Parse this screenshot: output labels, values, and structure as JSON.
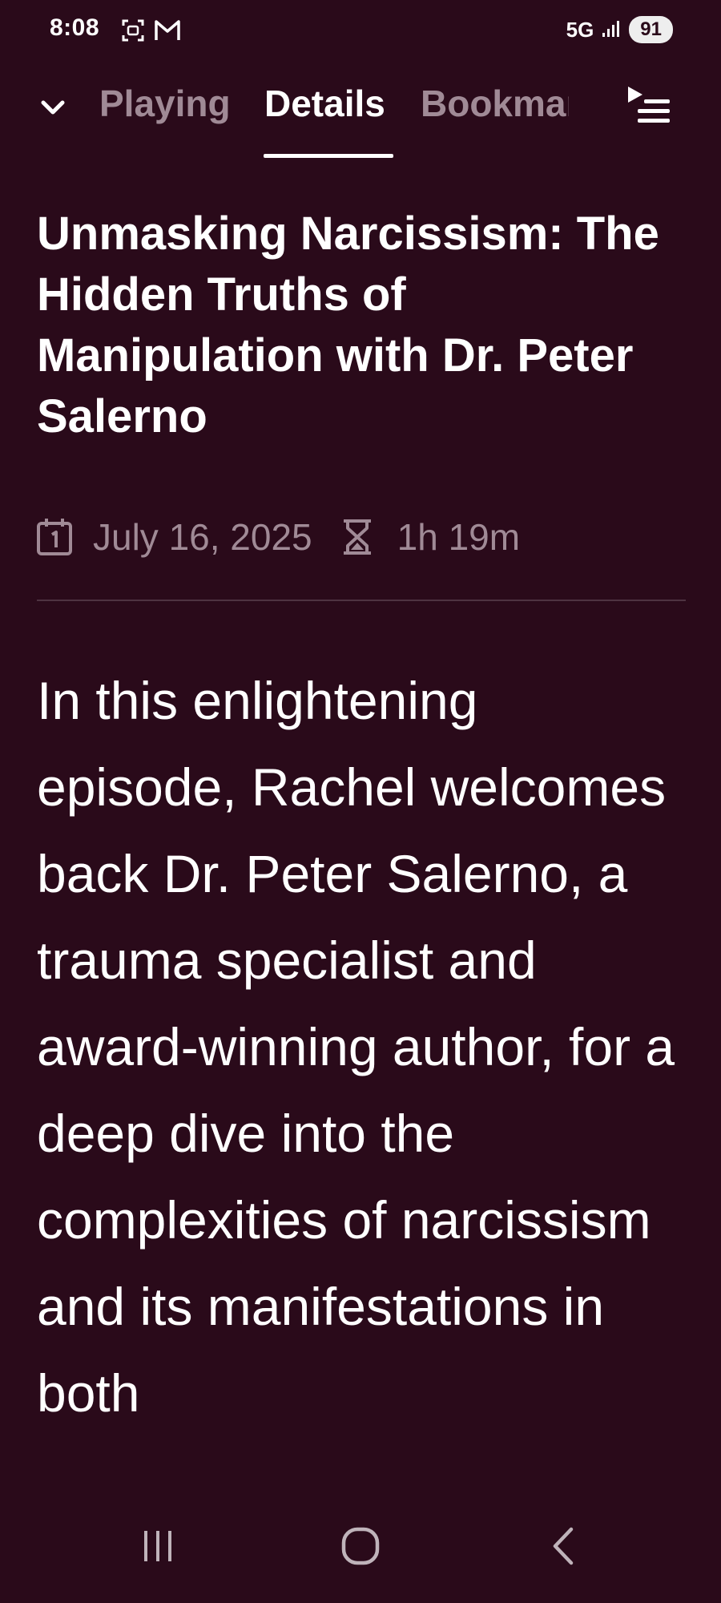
{
  "status_bar": {
    "time": "8:08",
    "network": "5G",
    "battery": "91"
  },
  "tabs": [
    {
      "label": "Playing",
      "active": false
    },
    {
      "label": "Details",
      "active": true
    },
    {
      "label": "Bookmarks",
      "active": false
    }
  ],
  "episode": {
    "title": "Unmasking Narcissism: The Hidden Truths of Manipulation with Dr. Peter Salerno",
    "date": "July 16, 2025",
    "duration": "1h 19m",
    "description": "In this enlightening episode, Rachel welcomes back Dr. Peter Salerno, a trauma specialist and award-winning author, for a deep dive into the complexities of narcissism and its manifestations in both"
  },
  "icons": {
    "collapse": "chevron-down-icon",
    "queue": "play-queue-icon",
    "date": "calendar-icon",
    "duration": "hourglass-icon"
  },
  "colors": {
    "background": "#2a0a1a",
    "primary_text": "#ffffff",
    "secondary_text": "#a08a96",
    "divider": "#4e3341"
  }
}
